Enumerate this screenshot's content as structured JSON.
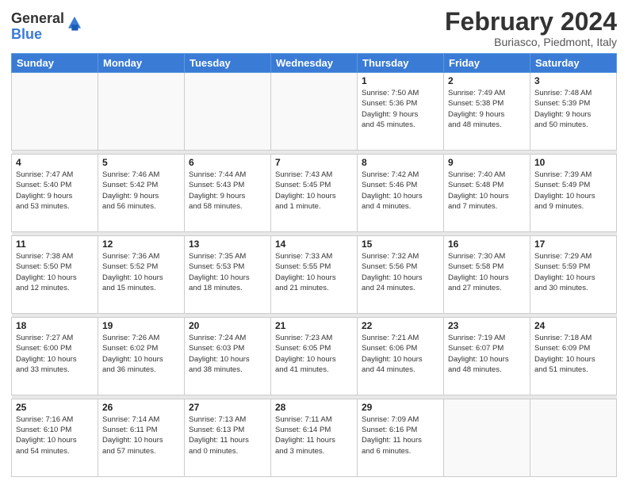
{
  "logo": {
    "general": "General",
    "blue": "Blue"
  },
  "header": {
    "month_year": "February 2024",
    "location": "Buriasco, Piedmont, Italy"
  },
  "days_of_week": [
    "Sunday",
    "Monday",
    "Tuesday",
    "Wednesday",
    "Thursday",
    "Friday",
    "Saturday"
  ],
  "weeks": [
    [
      {
        "day": "",
        "info": ""
      },
      {
        "day": "",
        "info": ""
      },
      {
        "day": "",
        "info": ""
      },
      {
        "day": "",
        "info": ""
      },
      {
        "day": "1",
        "info": "Sunrise: 7:50 AM\nSunset: 5:36 PM\nDaylight: 9 hours\nand 45 minutes."
      },
      {
        "day": "2",
        "info": "Sunrise: 7:49 AM\nSunset: 5:38 PM\nDaylight: 9 hours\nand 48 minutes."
      },
      {
        "day": "3",
        "info": "Sunrise: 7:48 AM\nSunset: 5:39 PM\nDaylight: 9 hours\nand 50 minutes."
      }
    ],
    [
      {
        "day": "4",
        "info": "Sunrise: 7:47 AM\nSunset: 5:40 PM\nDaylight: 9 hours\nand 53 minutes."
      },
      {
        "day": "5",
        "info": "Sunrise: 7:46 AM\nSunset: 5:42 PM\nDaylight: 9 hours\nand 56 minutes."
      },
      {
        "day": "6",
        "info": "Sunrise: 7:44 AM\nSunset: 5:43 PM\nDaylight: 9 hours\nand 58 minutes."
      },
      {
        "day": "7",
        "info": "Sunrise: 7:43 AM\nSunset: 5:45 PM\nDaylight: 10 hours\nand 1 minute."
      },
      {
        "day": "8",
        "info": "Sunrise: 7:42 AM\nSunset: 5:46 PM\nDaylight: 10 hours\nand 4 minutes."
      },
      {
        "day": "9",
        "info": "Sunrise: 7:40 AM\nSunset: 5:48 PM\nDaylight: 10 hours\nand 7 minutes."
      },
      {
        "day": "10",
        "info": "Sunrise: 7:39 AM\nSunset: 5:49 PM\nDaylight: 10 hours\nand 9 minutes."
      }
    ],
    [
      {
        "day": "11",
        "info": "Sunrise: 7:38 AM\nSunset: 5:50 PM\nDaylight: 10 hours\nand 12 minutes."
      },
      {
        "day": "12",
        "info": "Sunrise: 7:36 AM\nSunset: 5:52 PM\nDaylight: 10 hours\nand 15 minutes."
      },
      {
        "day": "13",
        "info": "Sunrise: 7:35 AM\nSunset: 5:53 PM\nDaylight: 10 hours\nand 18 minutes."
      },
      {
        "day": "14",
        "info": "Sunrise: 7:33 AM\nSunset: 5:55 PM\nDaylight: 10 hours\nand 21 minutes."
      },
      {
        "day": "15",
        "info": "Sunrise: 7:32 AM\nSunset: 5:56 PM\nDaylight: 10 hours\nand 24 minutes."
      },
      {
        "day": "16",
        "info": "Sunrise: 7:30 AM\nSunset: 5:58 PM\nDaylight: 10 hours\nand 27 minutes."
      },
      {
        "day": "17",
        "info": "Sunrise: 7:29 AM\nSunset: 5:59 PM\nDaylight: 10 hours\nand 30 minutes."
      }
    ],
    [
      {
        "day": "18",
        "info": "Sunrise: 7:27 AM\nSunset: 6:00 PM\nDaylight: 10 hours\nand 33 minutes."
      },
      {
        "day": "19",
        "info": "Sunrise: 7:26 AM\nSunset: 6:02 PM\nDaylight: 10 hours\nand 36 minutes."
      },
      {
        "day": "20",
        "info": "Sunrise: 7:24 AM\nSunset: 6:03 PM\nDaylight: 10 hours\nand 38 minutes."
      },
      {
        "day": "21",
        "info": "Sunrise: 7:23 AM\nSunset: 6:05 PM\nDaylight: 10 hours\nand 41 minutes."
      },
      {
        "day": "22",
        "info": "Sunrise: 7:21 AM\nSunset: 6:06 PM\nDaylight: 10 hours\nand 44 minutes."
      },
      {
        "day": "23",
        "info": "Sunrise: 7:19 AM\nSunset: 6:07 PM\nDaylight: 10 hours\nand 48 minutes."
      },
      {
        "day": "24",
        "info": "Sunrise: 7:18 AM\nSunset: 6:09 PM\nDaylight: 10 hours\nand 51 minutes."
      }
    ],
    [
      {
        "day": "25",
        "info": "Sunrise: 7:16 AM\nSunset: 6:10 PM\nDaylight: 10 hours\nand 54 minutes."
      },
      {
        "day": "26",
        "info": "Sunrise: 7:14 AM\nSunset: 6:11 PM\nDaylight: 10 hours\nand 57 minutes."
      },
      {
        "day": "27",
        "info": "Sunrise: 7:13 AM\nSunset: 6:13 PM\nDaylight: 11 hours\nand 0 minutes."
      },
      {
        "day": "28",
        "info": "Sunrise: 7:11 AM\nSunset: 6:14 PM\nDaylight: 11 hours\nand 3 minutes."
      },
      {
        "day": "29",
        "info": "Sunrise: 7:09 AM\nSunset: 6:16 PM\nDaylight: 11 hours\nand 6 minutes."
      },
      {
        "day": "",
        "info": ""
      },
      {
        "day": "",
        "info": ""
      }
    ]
  ]
}
